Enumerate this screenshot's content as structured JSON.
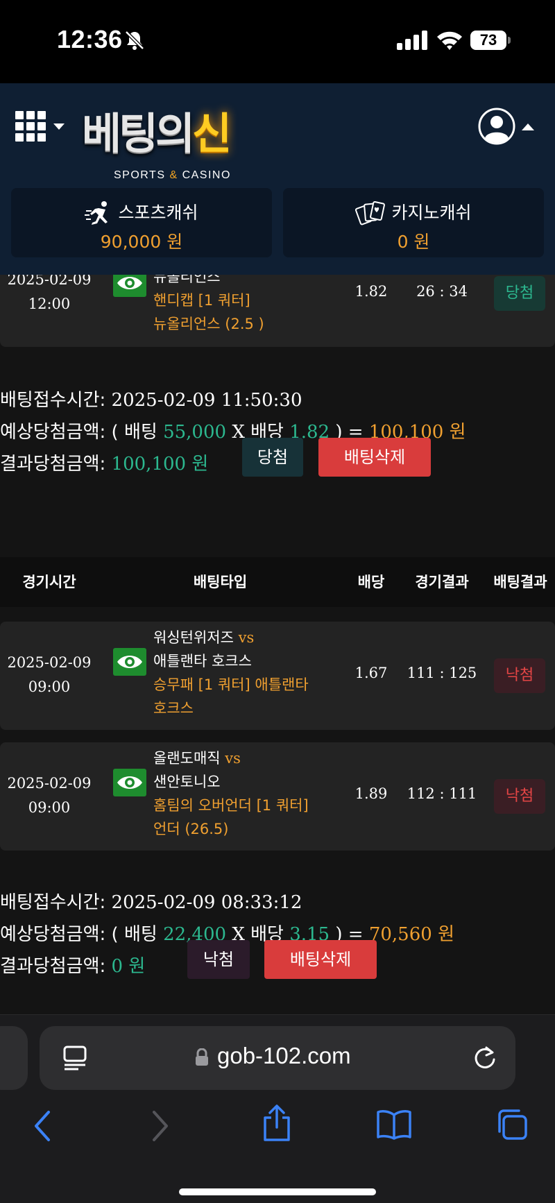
{
  "status_bar": {
    "time": "12:36",
    "battery": "73"
  },
  "header": {
    "logo_main_a": "베팅의",
    "logo_main_b": "신",
    "logo_sub_a": "SPORTS",
    "logo_sub_amp": "&",
    "logo_sub_b": "CASINO",
    "sports_cash": {
      "label": "스포츠캐쉬",
      "value": "90,000 원"
    },
    "casino_cash": {
      "label": "카지노캐쉬",
      "value": "0 원"
    }
  },
  "bet1": {
    "rows": [
      {
        "date": "2025-02-09",
        "time": "12:00",
        "teams_line": "뉴올리언스",
        "pick_line1": "핸디캡 [1 쿼터]",
        "pick_line2": "뉴올리언스 (2.5 )",
        "odds": "1.82",
        "score": "26 : 34",
        "result": "당첨"
      }
    ],
    "summary": {
      "received_label": "배팅접수시간:",
      "received_value": "2025-02-09 11:50:30",
      "expected_label": "예상당첨금액:",
      "open": "( 배팅",
      "stake": "55,000",
      "x": "X",
      "odds_word": "배당",
      "odds": "1.82",
      "close": ") =",
      "expected": "100,100 원",
      "result_label": "결과당첨금액:",
      "result_value": "100,100 원",
      "status": "당첨",
      "delete": "배팅삭제"
    }
  },
  "table_header": {
    "time": "경기시간",
    "type": "배팅타입",
    "odds": "배당",
    "score": "경기결과",
    "result": "배팅결과"
  },
  "bet2": {
    "rows": [
      {
        "date": "2025-02-09",
        "time": "09:00",
        "home": "워싱턴위저즈",
        "vs": "vs",
        "away": "애틀랜타 호크스",
        "pick_line1": "승무패 [1 쿼터] 애틀랜타",
        "pick_line2": "호크스",
        "odds": "1.67",
        "score": "111 : 125",
        "result": "낙첨"
      },
      {
        "date": "2025-02-09",
        "time": "09:00",
        "home": "올랜도매직",
        "vs": "vs",
        "away": "샌안토니오",
        "pick_line1": "홈팀의 오버언더 [1 쿼터]",
        "pick_line2": "언더 (26.5)",
        "odds": "1.89",
        "score": "112 : 111",
        "result": "낙첨"
      }
    ],
    "summary": {
      "received_label": "배팅접수시간:",
      "received_value": "2025-02-09 08:33:12",
      "expected_label": "예상당첨금액:",
      "open": "( 배팅",
      "stake": "22,400",
      "x": "X",
      "odds_word": "배당",
      "odds": "3.15",
      "close": ") =",
      "expected": "70,560 원",
      "result_label": "결과당첨금액:",
      "result_value": "0 원",
      "status": "낙첨",
      "delete": "배팅삭제"
    }
  },
  "browser": {
    "url": "gob-102.com"
  },
  "colors": {
    "accent_orange": "#f0a030",
    "win_green": "#2cb88f",
    "lose_red": "#e44545",
    "delete_red": "#d93c3c",
    "header_navy": "#0f1f33"
  }
}
